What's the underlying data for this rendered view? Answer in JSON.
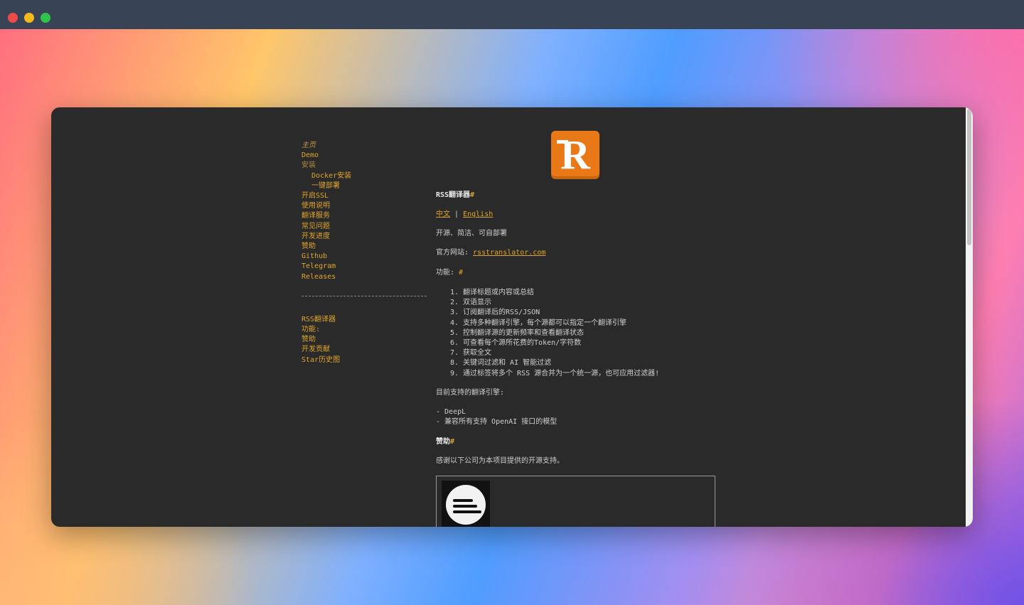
{
  "window": {
    "controls": [
      "close",
      "minimize",
      "maximize"
    ]
  },
  "sidebar": {
    "nav": [
      {
        "label": "主页",
        "style": "active"
      },
      {
        "label": "Demo",
        "style": "link"
      },
      {
        "label": "安装",
        "style": "muted"
      },
      {
        "label": "Docker安装",
        "style": "sub"
      },
      {
        "label": "一键部署",
        "style": "sub"
      },
      {
        "label": "开启SSL",
        "style": "link"
      },
      {
        "label": "使用说明",
        "style": "link"
      },
      {
        "label": "翻译服务",
        "style": "link"
      },
      {
        "label": "常见问题",
        "style": "link"
      },
      {
        "label": "开发进度",
        "style": "link"
      },
      {
        "label": "赞助",
        "style": "link"
      },
      {
        "label": "Github",
        "style": "link"
      },
      {
        "label": "Telegram",
        "style": "link"
      },
      {
        "label": "Releases",
        "style": "link"
      }
    ],
    "toc": [
      "RSS翻译器",
      "功能:",
      "赞助",
      "开发贡献",
      "Star历史图"
    ]
  },
  "main": {
    "logo_letter": "R",
    "title": "RSS翻译器",
    "hash": "#",
    "lang_zh": "中文",
    "lang_sep": "|",
    "lang_en": "English",
    "tagline": "开源、简洁、可自部署",
    "website_label": "官方网站: ",
    "website_link": "rsstranslator.com",
    "features_heading": "功能: ",
    "features": [
      "翻译标题或内容或总结",
      "双语显示",
      "订阅翻译后的RSS/JSON",
      "支持多种翻译引擎，每个源都可以指定一个翻译引擎",
      "控制翻译源的更新频率和查看翻译状态",
      "可查看每个源所花费的Token/字符数",
      "获取全文",
      "关键词过滤和 AI 智能过滤",
      "通过标签将多个 RSS 源合并为一个统一源，也可应用过滤器!"
    ],
    "engines_intro": "目前支持的翻译引擎:",
    "engines": [
      "- DeepL",
      "- 兼容所有支持 OpenAI 接口的模型"
    ],
    "sponsor_heading": "赞助",
    "sponsor_text": "感谢以下公司为本项目提供的开源支持。"
  },
  "colors": {
    "accent": "#e0a52c",
    "page_bg": "#2a2a2a",
    "logo_bg": "#e97817",
    "titlebar": "#394356"
  }
}
